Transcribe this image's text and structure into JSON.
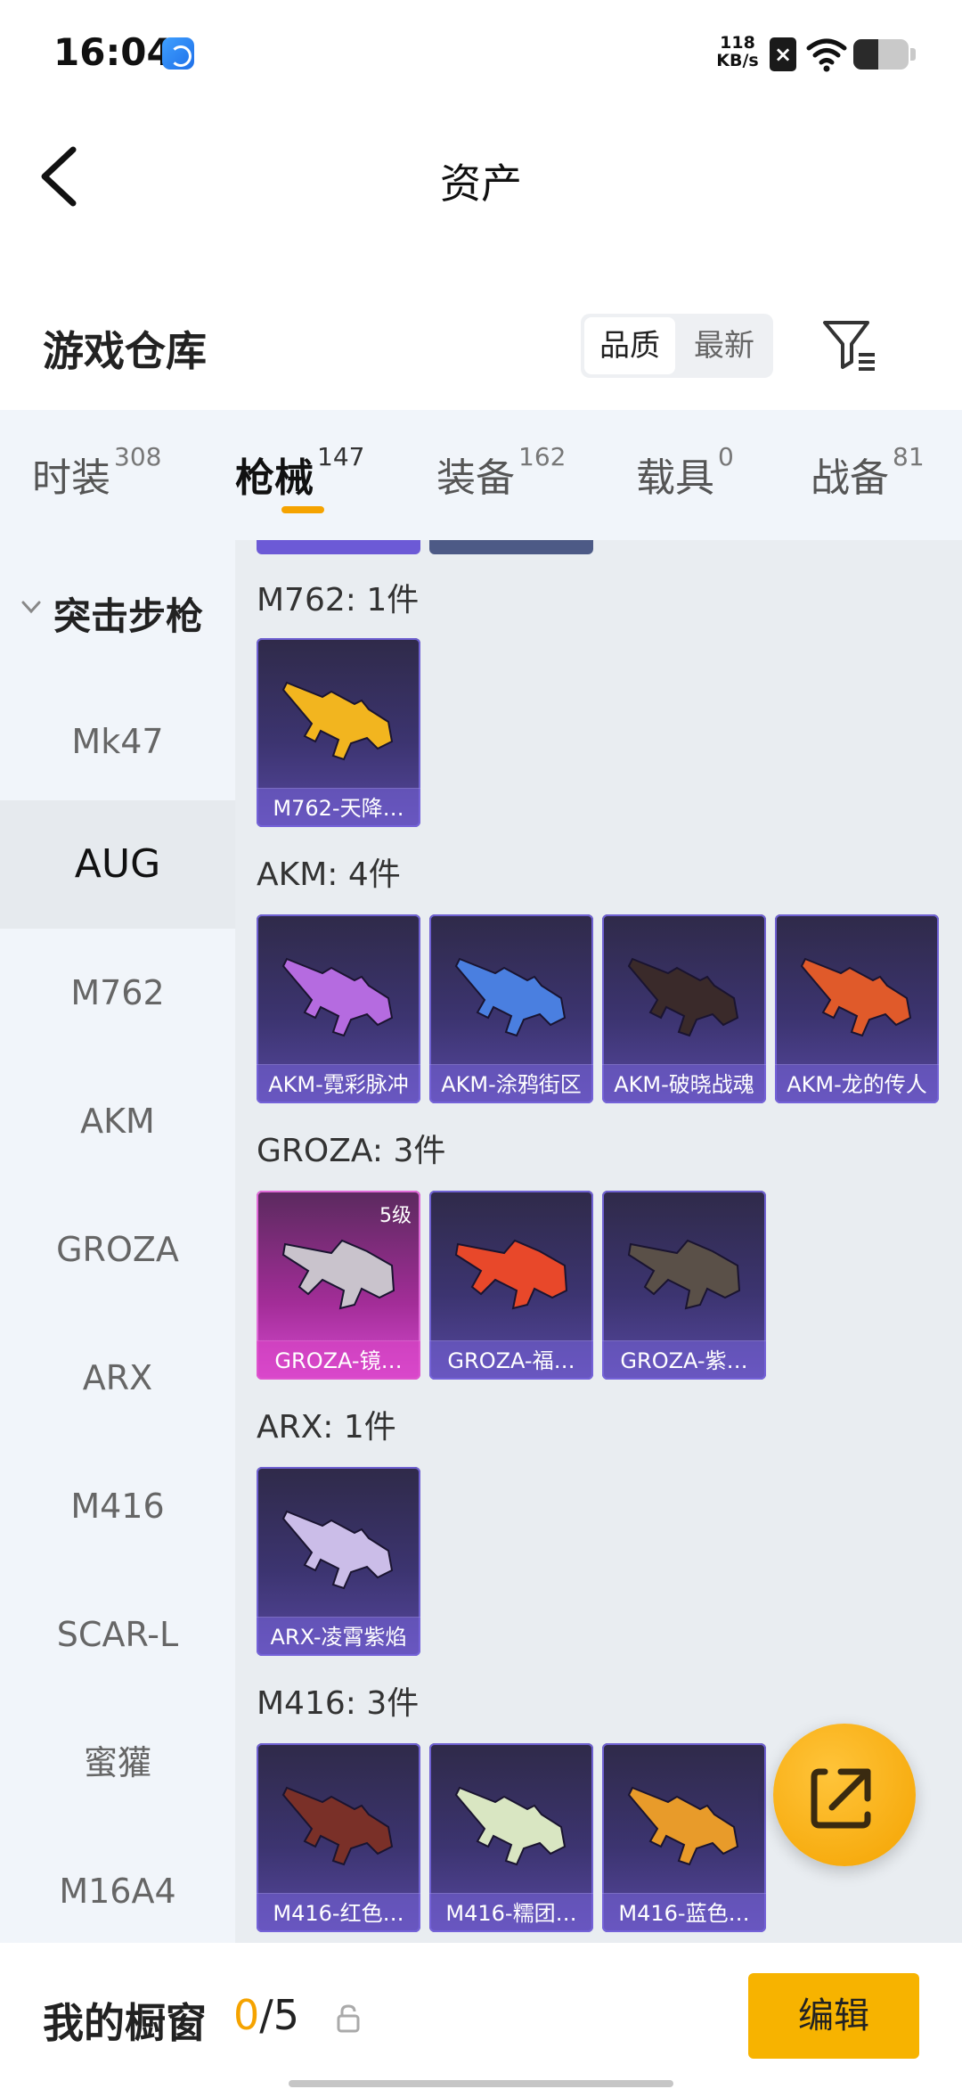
{
  "status_bar": {
    "time": "16:04",
    "net_speed_value": "118",
    "net_speed_unit": "KB/s",
    "battery_level": 0.45
  },
  "header": {
    "title": "资产"
  },
  "warehouse": {
    "title": "游戏仓库",
    "sort_options": [
      "品质",
      "最新"
    ],
    "sort_selected": "品质"
  },
  "tabs": [
    {
      "label": "时装",
      "count": "308"
    },
    {
      "label": "枪械",
      "count": "147",
      "active": true
    },
    {
      "label": "装备",
      "count": "162"
    },
    {
      "label": "载具",
      "count": "0"
    },
    {
      "label": "战备",
      "count": "81"
    }
  ],
  "sidebar": {
    "group": "突击步枪",
    "items": [
      "Mk47",
      "AUG",
      "M762",
      "AKM",
      "GROZA",
      "ARX",
      "M416",
      "SCAR-L",
      "蜜獾",
      "M16A4"
    ],
    "selected": "AUG"
  },
  "content": {
    "groups": [
      {
        "title": "M762: 1件",
        "skins": [
          {
            "name": "M762-天降…",
            "color": "#f2b51f"
          }
        ]
      },
      {
        "title": "AKM: 4件",
        "skins": [
          {
            "name": "AKM-霓彩脉冲",
            "color": "#b56be0"
          },
          {
            "name": "AKM-涂鸦街区",
            "color": "#4a7fe0"
          },
          {
            "name": "AKM-破晓战魂",
            "color": "#3a2a2a"
          },
          {
            "name": "AKM-龙的传人",
            "color": "#e05a2a"
          }
        ]
      },
      {
        "title": "GROZA: 3件",
        "skins": [
          {
            "name": "GROZA-镜…",
            "color": "#c9c3cc",
            "level": "5级"
          },
          {
            "name": "GROZA-福…",
            "color": "#e8482a"
          },
          {
            "name": "GROZA-紫…",
            "color": "#5a5048"
          }
        ]
      },
      {
        "title": "ARX: 1件",
        "skins": [
          {
            "name": "ARX-凌霄紫焰",
            "color": "#cbbde8"
          }
        ]
      },
      {
        "title": "M416: 3件",
        "skins": [
          {
            "name": "M416-红色…",
            "color": "#7a3028"
          },
          {
            "name": "M416-糯团…",
            "color": "#d9e6c2"
          },
          {
            "name": "M416-蓝色…",
            "color": "#e89b2a"
          }
        ]
      }
    ]
  },
  "bottom_bar": {
    "label": "我的橱窗",
    "current": "0",
    "total": "/5",
    "edit_label": "编辑"
  },
  "colors": {
    "accent": "#f5a300",
    "edit_button": "#f7b300",
    "card_purple": "#4a3f86",
    "card_legendary": "#c237b6"
  }
}
